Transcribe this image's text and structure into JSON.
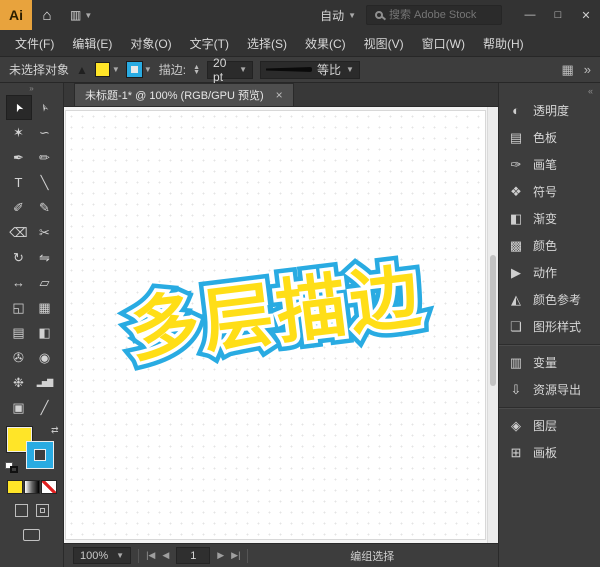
{
  "titlebar": {
    "app_logo": "Ai",
    "auto_label": "自动",
    "search_placeholder": "搜索 Adobe Stock",
    "window": {
      "minimize": "—",
      "maximize": "□",
      "close": "✕"
    }
  },
  "menubar": {
    "items": [
      "文件(F)",
      "编辑(E)",
      "对象(O)",
      "文字(T)",
      "选择(S)",
      "效果(C)",
      "视图(V)",
      "窗口(W)",
      "帮助(H)"
    ]
  },
  "controlbar": {
    "status": "未选择对象",
    "stroke_label": "描边:",
    "stroke_value": "20 pt",
    "profile_label": "等比"
  },
  "tabbar": {
    "title": "未标题-1* @ 100% (RGB/GPU 预览)",
    "close_glyph": "×"
  },
  "canvas": {
    "wordart_text": "多层描边"
  },
  "colors": {
    "fill_yellow": "#FFE528",
    "stroke_blue": "#29ABE2",
    "art_yellow": "#FFDE17",
    "art_blue": "#29ABE2"
  },
  "tools": [
    {
      "name": "selection",
      "glyph": "➤"
    },
    {
      "name": "direct-selection",
      "glyph": "➣"
    },
    {
      "name": "magic-wand",
      "glyph": "✶"
    },
    {
      "name": "lasso",
      "glyph": "∽"
    },
    {
      "name": "pen",
      "glyph": "✒"
    },
    {
      "name": "curvature",
      "glyph": "✏"
    },
    {
      "name": "type",
      "glyph": "T"
    },
    {
      "name": "line-segment",
      "glyph": "╲"
    },
    {
      "name": "paintbrush",
      "glyph": "✐"
    },
    {
      "name": "pencil",
      "glyph": "✎"
    },
    {
      "name": "eraser",
      "glyph": "⌫"
    },
    {
      "name": "scissors",
      "glyph": "✂"
    },
    {
      "name": "rotate",
      "glyph": "↻"
    },
    {
      "name": "reflect",
      "glyph": "⇋"
    },
    {
      "name": "width",
      "glyph": "↔"
    },
    {
      "name": "free-transform",
      "glyph": "▱"
    },
    {
      "name": "shape-builder",
      "glyph": "◱"
    },
    {
      "name": "perspective-grid",
      "glyph": "▦"
    },
    {
      "name": "mesh",
      "glyph": "▤"
    },
    {
      "name": "gradient",
      "glyph": "◧"
    },
    {
      "name": "eyedropper",
      "glyph": "✇"
    },
    {
      "name": "blend",
      "glyph": "◉"
    },
    {
      "name": "symbol-sprayer",
      "glyph": "❉"
    },
    {
      "name": "column-graph",
      "glyph": "▂▅▇"
    },
    {
      "name": "artboard",
      "glyph": "▣"
    },
    {
      "name": "slice",
      "glyph": "╱"
    }
  ],
  "right_panel": {
    "items": [
      {
        "label": "透明度",
        "glyph": "◐"
      },
      {
        "label": "色板",
        "glyph": "▤"
      },
      {
        "label": "画笔",
        "glyph": "✑"
      },
      {
        "label": "符号",
        "glyph": "❖"
      },
      {
        "label": "渐变",
        "glyph": "◧"
      },
      {
        "label": "颜色",
        "glyph": "▩"
      },
      {
        "label": "动作",
        "glyph": "▶"
      },
      {
        "label": "颜色参考",
        "glyph": "◭"
      },
      {
        "label": "图形样式",
        "glyph": "❏"
      },
      {
        "label": "变量",
        "glyph": "▥"
      },
      {
        "label": "资源导出",
        "glyph": "⇩"
      },
      {
        "label": "图层",
        "glyph": "◈"
      },
      {
        "label": "画板",
        "glyph": "⊞"
      }
    ]
  },
  "statusbar": {
    "zoom": "100%",
    "artboard_field": "1",
    "nav": {
      "first": "|◀",
      "prev": "◀",
      "next": "▶",
      "last": "▶|"
    },
    "selection_status": "编组选择"
  }
}
